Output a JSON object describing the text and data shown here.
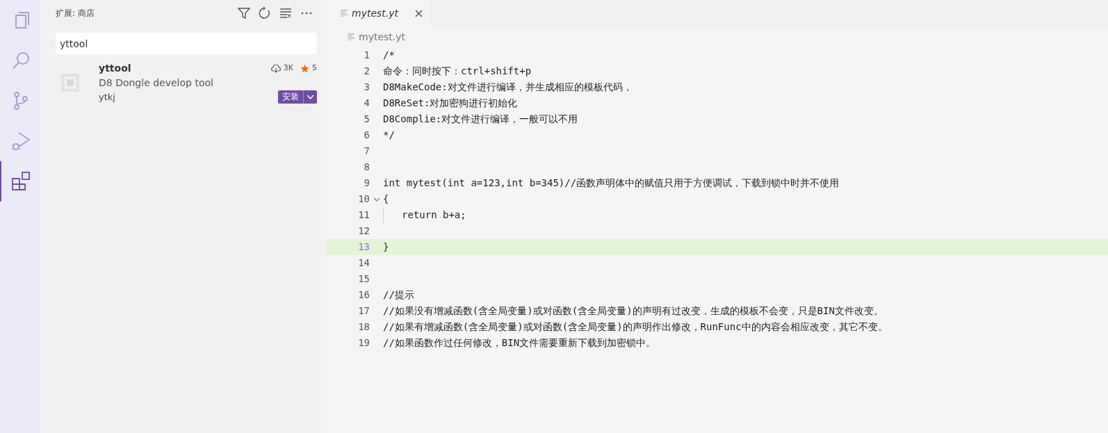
{
  "activity_bar": [
    {
      "kind": "explorer",
      "selected": false
    },
    {
      "kind": "search",
      "selected": false
    },
    {
      "kind": "source-control",
      "selected": false
    },
    {
      "kind": "run-debug",
      "selected": false
    },
    {
      "kind": "extensions",
      "selected": true
    }
  ],
  "sidebar": {
    "title": "扩展: 商店",
    "search": {
      "value": "yttool"
    },
    "extensions": [
      {
        "name": "yttool",
        "description": "D8 Dongle develop tool",
        "publisher": "ytkj",
        "downloads": "3K",
        "rating": "5",
        "install_label": "安装"
      }
    ]
  },
  "editor": {
    "tabs": [
      {
        "label": "mytest.yt",
        "selected": true
      }
    ],
    "breadcrumb": "mytest.yt",
    "lines": [
      {
        "number": "1",
        "text": "/*",
        "current": false,
        "indented": false
      },
      {
        "number": "2",
        "text": "命令：同时按下：ctrl+shift+p",
        "current": false,
        "indented": false
      },
      {
        "number": "3",
        "text": "D8MakeCode:对文件进行编译，并生成相应的模板代码，",
        "current": false,
        "indented": false
      },
      {
        "number": "4",
        "text": "D8ReSet:对加密狗进行初始化",
        "current": false,
        "indented": false
      },
      {
        "number": "5",
        "text": "D8Complie:对文件进行编译，一般可以不用",
        "current": false,
        "indented": false
      },
      {
        "number": "6",
        "text": "*/",
        "current": false,
        "indented": false
      },
      {
        "number": "7",
        "current": false,
        "indented": false
      },
      {
        "number": "8",
        "current": false,
        "indented": false
      },
      {
        "number": "9",
        "text": "int mytest(int a=123,int b=345)//函数声明体中的赋值只用于方便调试，下载到锁中时并不使用",
        "current": false,
        "indented": false
      },
      {
        "number": "10",
        "text": "{",
        "current": false,
        "indented": false
      },
      {
        "number": "11",
        "text": "return b+a;",
        "current": false,
        "indented": true
      },
      {
        "number": "12",
        "current": false,
        "indented": false
      },
      {
        "number": "13",
        "text": "}",
        "current": true,
        "indented": false
      },
      {
        "number": "14",
        "current": false,
        "indented": false
      },
      {
        "number": "15",
        "current": false,
        "indented": false
      },
      {
        "number": "16",
        "text": "//提示",
        "current": false,
        "indented": false
      },
      {
        "number": "17",
        "text": "//如果没有增减函数(含全局变量)或对函数(含全局变量)的声明有过改变，生成的模板不会变，只是BIN文件改变。",
        "current": false,
        "indented": false
      },
      {
        "number": "18",
        "text": "//如果有增减函数(含全局变量)或对函数(含全局变量)的声明作出修改，RunFunc中的内容会相应改变，其它不变。",
        "current": false,
        "indented": false
      },
      {
        "number": "19",
        "text": "//如果函数作过任何修改，BIN文件需要重新下载到加密锁中。",
        "current": false,
        "indented": false
      }
    ]
  }
}
